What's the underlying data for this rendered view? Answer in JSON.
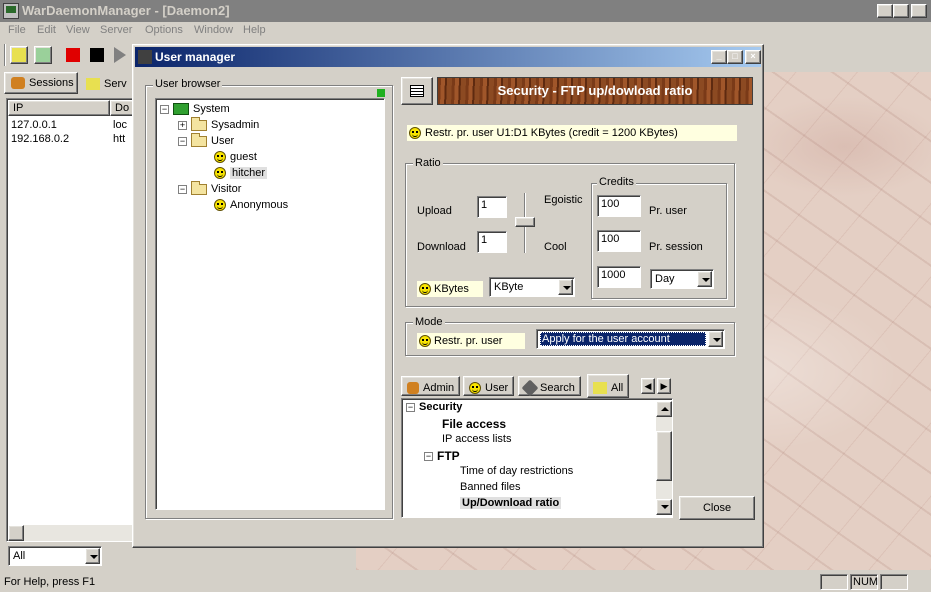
{
  "app": {
    "title": "WarDaemonManager - [Daemon2]"
  },
  "menu": [
    "File",
    "Edit",
    "View",
    "Server",
    "Options",
    "Window",
    "Help"
  ],
  "left_pane": {
    "tabs": [
      "Sessions",
      "Serv"
    ],
    "columns": [
      "IP",
      "Do"
    ],
    "rows": [
      {
        "ip": "127.0.0.1",
        "do": "loc"
      },
      {
        "ip": "192.168.0.2",
        "do": "htt"
      }
    ],
    "filter_value": "All"
  },
  "status": {
    "help_text": "For Help, press F1",
    "num": "NUM"
  },
  "dialog": {
    "title": "User manager",
    "user_browser_label": "User browser",
    "tree": [
      {
        "label": "System"
      },
      {
        "label": "Sysadmin"
      },
      {
        "label": "User"
      },
      {
        "label": "guest"
      },
      {
        "label": "hitcher"
      },
      {
        "label": "Visitor"
      },
      {
        "label": "Anonymous"
      }
    ],
    "section_header": "Security - FTP up/dowload ratio",
    "info_line": "Restr. pr. user U1:D1 KBytes (credit = 1200 KBytes)",
    "ratio": {
      "group_label": "Ratio",
      "upload_label": "Upload",
      "upload_value": "1",
      "download_label": "Download",
      "download_value": "1",
      "egoistic_label": "Egoistic",
      "cool_label": "Cool",
      "kbytes_label": "KBytes",
      "unit_select": "KByte",
      "credits": {
        "group_label": "Credits",
        "per_user_value": "100",
        "per_user_label": "Pr. user",
        "per_session_value": "100",
        "per_session_label": "Pr. session",
        "period_value": "1000",
        "period_select": "Day"
      }
    },
    "mode": {
      "group_label": "Mode",
      "badge_label": "Restr. pr. user",
      "select_value": "Apply for the user account"
    },
    "bottom_tabs": [
      "Admin",
      "User",
      "Search",
      "All"
    ],
    "settings_tree": [
      {
        "label": "Security",
        "bold": true
      },
      {
        "label": "File access",
        "bold": true
      },
      {
        "label": "IP access lists",
        "bold": false
      },
      {
        "label": "FTP",
        "bold": true
      },
      {
        "label": "Time of day restrictions",
        "bold": false
      },
      {
        "label": "Banned files",
        "bold": false
      },
      {
        "label": "Up/Download ratio",
        "bold": true
      }
    ],
    "close_label": "Close"
  }
}
